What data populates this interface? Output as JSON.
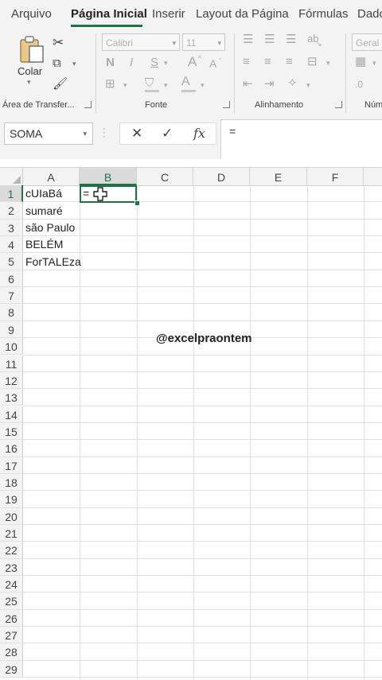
{
  "tabs": [
    "Arquivo",
    "Página Inicial",
    "Inserir",
    "Layout da Página",
    "Fórmulas",
    "Dado"
  ],
  "active_tab_index": 1,
  "ribbon": {
    "clipboard": {
      "paste_label": "Colar",
      "group_label": "Área de Transfer..."
    },
    "font": {
      "font_name": "Calibri",
      "font_size": "11",
      "bold": "N",
      "italic": "I",
      "underline": "S",
      "grow": "A",
      "shrink": "A",
      "font_color": "A",
      "group_label": "Fonte"
    },
    "alignment": {
      "group_label": "Alinhamento"
    },
    "number": {
      "format": "Geral",
      "group_label": "Núm"
    }
  },
  "formula_bar": {
    "name_box": "SOMA",
    "cancel": "✕",
    "enter": "✓",
    "fx": "fx",
    "content": "="
  },
  "grid": {
    "columns": [
      "A",
      "B",
      "C",
      "D",
      "E",
      "F"
    ],
    "selected_column": "B",
    "rows": [
      "1",
      "2",
      "3",
      "4",
      "5",
      "6",
      "7",
      "8",
      "9",
      "10",
      "11",
      "12",
      "13",
      "14",
      "15",
      "16",
      "17",
      "18",
      "19",
      "20",
      "21",
      "22",
      "23",
      "24",
      "25",
      "26",
      "27",
      "28",
      "29"
    ],
    "selected_row": "1",
    "cells": {
      "A1": "cUIaBá",
      "A2": "sumaré",
      "A3": "são Paulo",
      "A4": "BELÉM",
      "A5": "ForTALEza",
      "B1": "="
    }
  },
  "watermark": "@excelpraontem",
  "colors": {
    "accent": "#217346",
    "ribbon_bg": "#f3f3f3",
    "header_sel": "#dadada"
  }
}
